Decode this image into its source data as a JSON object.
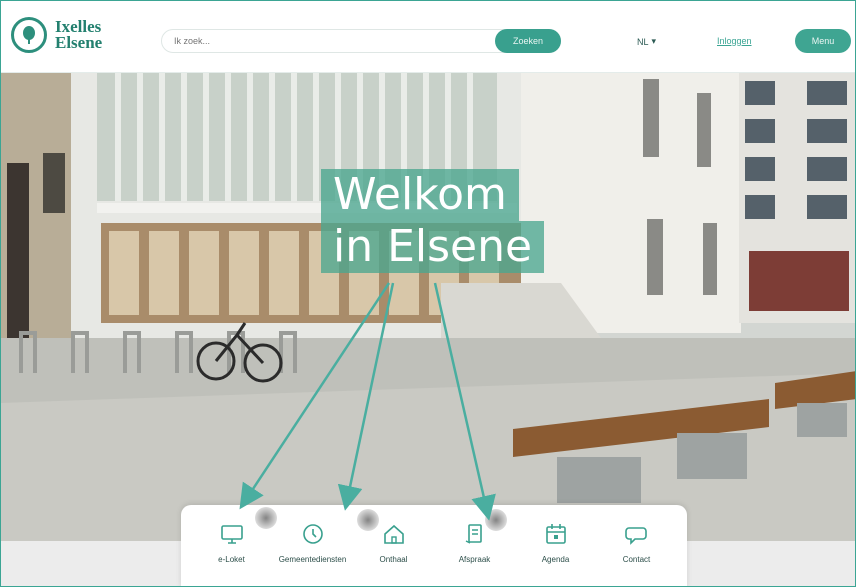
{
  "header": {
    "logo_line1": "Ixelles",
    "logo_line2": "Elsene",
    "search_placeholder": "Ik zoek...",
    "search_button": "Zoeken",
    "language": "NL",
    "login": "Inloggen",
    "menu": "Menu"
  },
  "hero": {
    "welcome_line1": "Welkom",
    "welcome_line2": "in Elsene"
  },
  "quicklinks": [
    {
      "label": "e-Loket",
      "icon": "monitor-icon"
    },
    {
      "label": "Gemeentediensten",
      "icon": "clock-icon"
    },
    {
      "label": "Onthaal",
      "icon": "home-icon"
    },
    {
      "label": "Afspraak",
      "icon": "document-icon"
    },
    {
      "label": "Agenda",
      "icon": "calendar-icon"
    },
    {
      "label": "Contact",
      "icon": "chat-icon"
    }
  ],
  "colors": {
    "brand": "#39a08e",
    "text": "#2d4f4a",
    "annotation_arrow": "#4aaea0"
  }
}
